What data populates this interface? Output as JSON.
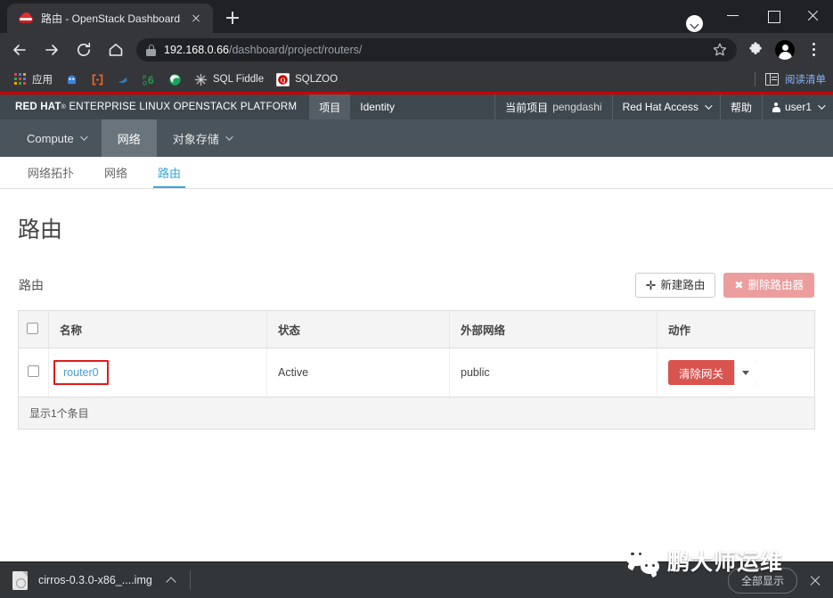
{
  "browser": {
    "tab": {
      "title": "路由 - OpenStack Dashboard",
      "favicon": "redhat-fedora-icon",
      "close_label": "×"
    },
    "new_tab_label": "+",
    "window_controls": {
      "minimize": "—",
      "maximize": "□",
      "close": "✕"
    },
    "nav": {
      "back": "back-arrow",
      "forward": "forward-arrow",
      "reload": "reload-arrow",
      "home": "home-house"
    },
    "omnibox": {
      "lock": "lock-icon",
      "host": "192.168.0.66",
      "path": "/dashboard/project/routers/",
      "full_url": "192.168.0.66/dashboard/project/routers/"
    },
    "toolbar_icons": {
      "bookmark_star": "star-icon",
      "extensions": "puzzle-icon",
      "profile": "avatar-icon",
      "menu": "three-dots-icon"
    },
    "bookmarks": [
      {
        "label": "应用",
        "icon": "apps-grid-icon"
      },
      {
        "label": "",
        "icon": "blue-robot-icon",
        "color": "#3b82d9"
      },
      {
        "label": "",
        "icon": "orange-brackets-icon",
        "color": "#f26522"
      },
      {
        "label": "",
        "icon": "blue-dolphin-icon",
        "color": "#2b7fc4"
      },
      {
        "label": "",
        "icon": "poc6-icon",
        "color": "#1f9e4a"
      },
      {
        "label": "",
        "icon": "green-browser-icon",
        "color": "#1aa35a"
      },
      {
        "label": "SQL Fiddle",
        "icon": "gray-burst-icon",
        "color": "#b8b8b8"
      },
      {
        "label": "SQLZOO",
        "icon": "sqlzoo-icon",
        "color": "#cc0000"
      }
    ],
    "reading_list": {
      "label": "阅读清单",
      "icon": "reading-list-icon"
    }
  },
  "openstack": {
    "brand": {
      "red_hat": "RED HAT",
      "registered": "®",
      "rest": "ENTERPRISE LINUX OPENSTACK PLATFORM"
    },
    "top_nav": [
      {
        "label": "项目",
        "active": true
      },
      {
        "label": "Identity",
        "active": false
      }
    ],
    "top_nav_right": [
      {
        "label": "当前项目",
        "value": "pengdashi",
        "caret": false,
        "icon": ""
      },
      {
        "label": "Red Hat Access",
        "value": "",
        "caret": true,
        "icon": ""
      },
      {
        "label": "帮助",
        "value": "",
        "caret": false,
        "icon": ""
      },
      {
        "label": "user1",
        "value": "",
        "caret": true,
        "icon": "user-icon"
      }
    ],
    "sub_nav": [
      {
        "label": "Compute",
        "caret": true,
        "active": false
      },
      {
        "label": "网络",
        "caret": false,
        "active": true
      },
      {
        "label": "对象存储",
        "caret": true,
        "active": false
      }
    ],
    "page_tabs": [
      {
        "label": "网络拓扑",
        "active": false
      },
      {
        "label": "网络",
        "active": false
      },
      {
        "label": "路由",
        "active": true
      }
    ],
    "accent_color": "#cc0000",
    "tab_active_color": "#3ba6d8"
  },
  "main": {
    "page_title": "路由",
    "panel_title": "路由",
    "buttons": {
      "create_router": {
        "label": "新建路由",
        "icon": "plus-icon"
      },
      "delete_router": {
        "label": "删除路由器",
        "icon": "x-icon",
        "disabled": true
      }
    },
    "table": {
      "columns": [
        "",
        "名称",
        "状态",
        "外部网络",
        "动作"
      ],
      "rows": [
        {
          "selected": false,
          "name": "router0",
          "status": "Active",
          "external_network": "public",
          "action": {
            "label": "清除网关",
            "caret": "dropdown-caret-icon"
          },
          "annotated": true
        }
      ],
      "footer": "显示1个条目"
    },
    "annotation_color": "#e01b1b"
  },
  "download_shelf": {
    "item": {
      "filename": "cirros-0.3.0-x86_....img",
      "icon": "file-icon",
      "caret": "chevron-up-icon"
    },
    "show_all_label": "全部显示",
    "close_label": "×"
  },
  "watermark": {
    "text": "鹏大师运维",
    "logo": "wechat-icon"
  }
}
